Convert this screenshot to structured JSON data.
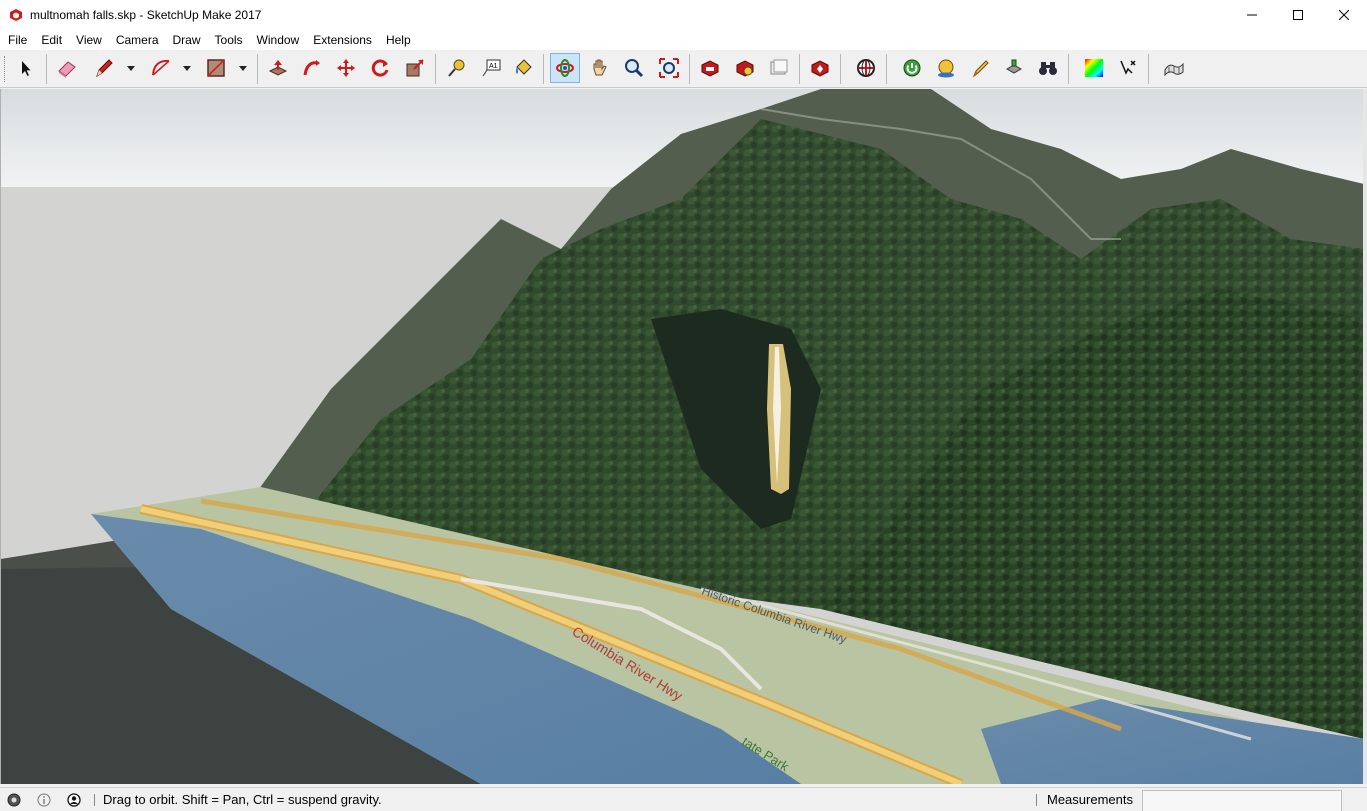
{
  "window": {
    "title": "multnomah falls.skp - SketchUp Make 2017"
  },
  "menu": [
    "File",
    "Edit",
    "View",
    "Camera",
    "Draw",
    "Tools",
    "Window",
    "Extensions",
    "Help"
  ],
  "toolbar": {
    "active_tool": "orbit",
    "tools": [
      "select",
      "eraser",
      "line",
      "arc",
      "shape",
      "push-pull",
      "follow-me",
      "move",
      "rotate",
      "scale",
      "tape-measure",
      "text",
      "paint-bucket",
      "orbit",
      "pan",
      "zoom",
      "zoom-extents",
      "3d-warehouse",
      "extension-warehouse",
      "send-to-layout",
      "extension-manager",
      "geo-location",
      "add-location",
      "shadows",
      "sandbox",
      "section",
      "binoculars",
      "color",
      "axes",
      "terrain"
    ]
  },
  "map_labels": {
    "road1": "Columbia River Hwy",
    "road2": "Historic Columbia River Hwy",
    "park": "tate Park"
  },
  "statusbar": {
    "hint": "Drag to orbit. Shift = Pan, Ctrl = suspend gravity.",
    "measurements_label": "Measurements",
    "measurements_value": ""
  },
  "colors": {
    "accent": "#cce4f7",
    "brand": "#d21a1a"
  }
}
